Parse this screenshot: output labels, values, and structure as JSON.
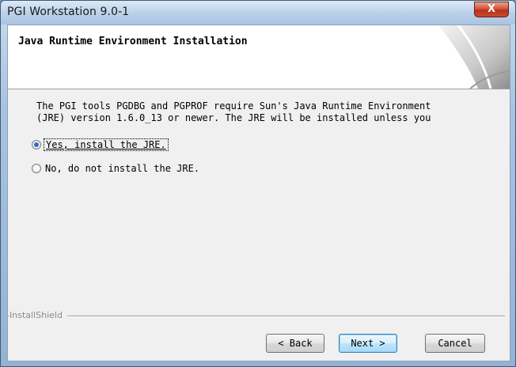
{
  "window": {
    "title": "PGI Workstation 9.0-1",
    "close_label": "X"
  },
  "header": {
    "title": "Java Runtime Environment Installation"
  },
  "body": {
    "line1": "The PGI tools PGDBG and PGPROF require Sun's Java Runtime Environment",
    "line2": "(JRE) version 1.6.0_13 or newer. The JRE will be installed unless you"
  },
  "options": [
    {
      "label": "Yes, install the JRE.",
      "checked": true
    },
    {
      "label": "No, do not install the JRE.",
      "checked": false
    }
  ],
  "footer": {
    "brand": "InstallShield"
  },
  "buttons": {
    "back": "< Back",
    "next": "Next >",
    "cancel": "Cancel"
  },
  "colors": {
    "accent": "#2a6fc9",
    "close_red": "#c94a30",
    "title_bar": "#bcd2ea"
  }
}
